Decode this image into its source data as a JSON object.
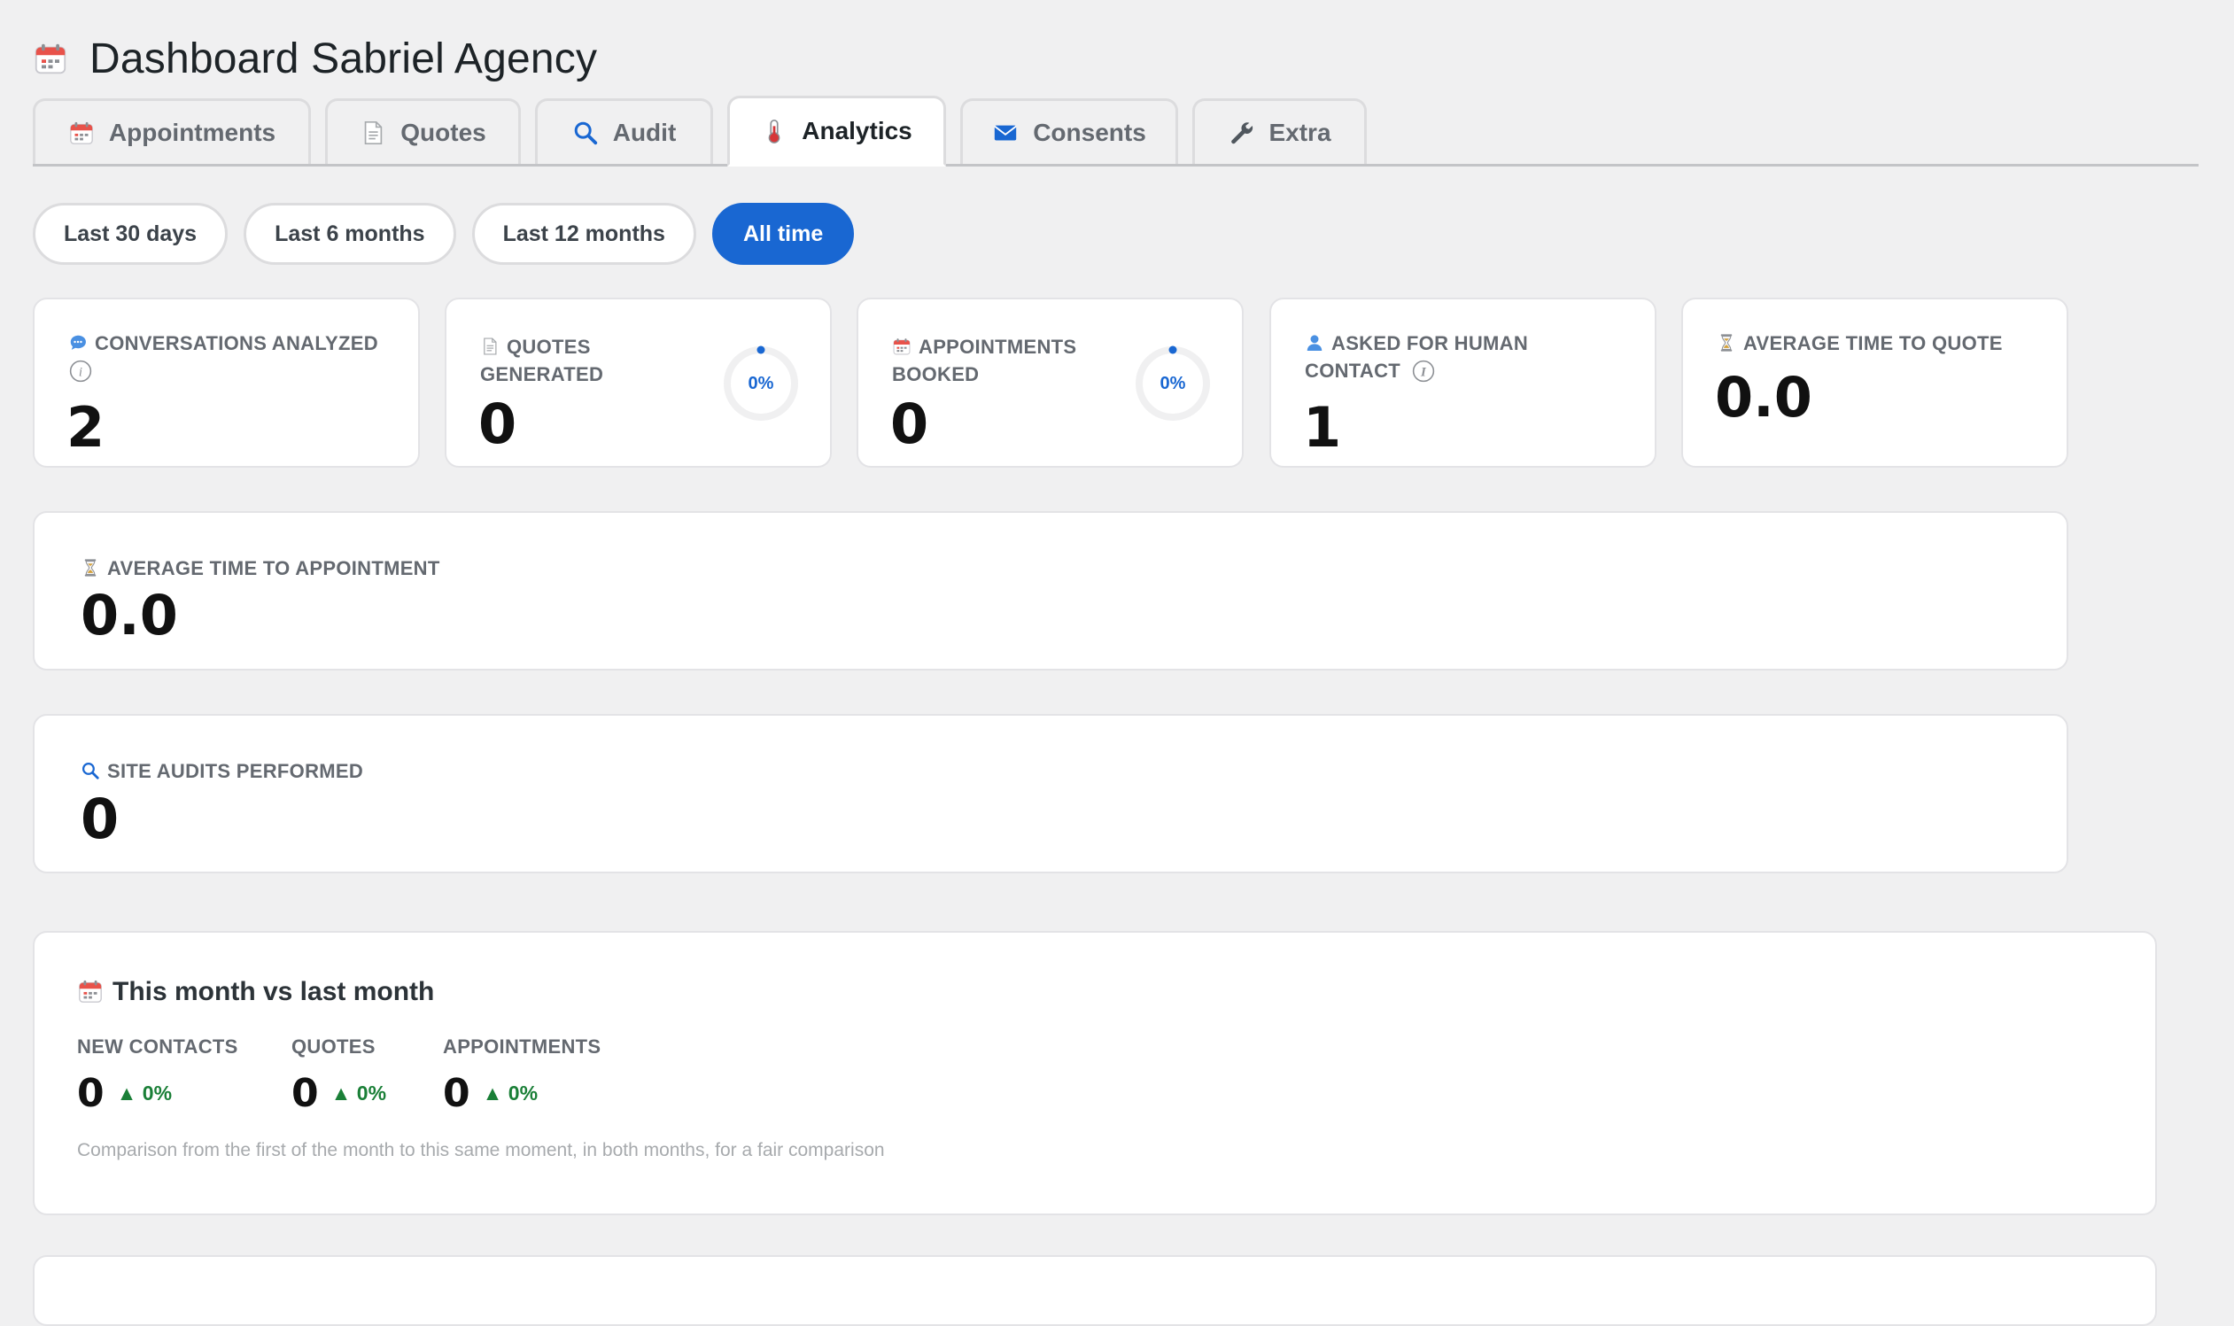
{
  "header": {
    "title": "Dashboard Sabriel Agency",
    "icon": "calendar-icon"
  },
  "tabs": [
    {
      "label": "Appointments",
      "icon": "calendar-icon",
      "active": false
    },
    {
      "label": "Quotes",
      "icon": "document-icon",
      "active": false
    },
    {
      "label": "Audit",
      "icon": "search-icon",
      "active": false
    },
    {
      "label": "Analytics",
      "icon": "thermometer-icon",
      "active": true
    },
    {
      "label": "Consents",
      "icon": "envelope-icon",
      "active": false
    },
    {
      "label": "Extra",
      "icon": "wrench-icon",
      "active": false
    }
  ],
  "filters": [
    {
      "label": "Last 30 days",
      "active": false
    },
    {
      "label": "Last 6 months",
      "active": false
    },
    {
      "label": "Last 12 months",
      "active": false
    },
    {
      "label": "All time",
      "active": true
    }
  ],
  "kpis": {
    "conversations": {
      "label": "CONVERSATIONS ANALYZED",
      "value": "2",
      "icon": "chat-bubble-icon"
    },
    "quotes": {
      "label_line1": "QUOTES",
      "label_line2": "GENERATED",
      "value": "0",
      "percent": "0%",
      "icon": "document-icon"
    },
    "appointments": {
      "label_line1": "APPOINTMENTS",
      "label_line2": "BOOKED",
      "value": "0",
      "percent": "0%",
      "icon": "calendar-icon"
    },
    "human_contact": {
      "label_line1": "ASKED FOR HUMAN",
      "label_line2": "CONTACT",
      "value": "1",
      "icon": "person-icon"
    },
    "avg_quote": {
      "label": "AVERAGE TIME TO QUOTE",
      "value": "0.0",
      "icon": "hourglass-icon"
    }
  },
  "avg_appointment": {
    "label": "AVERAGE TIME TO APPOINTMENT",
    "value": "0.0",
    "icon": "hourglass-icon"
  },
  "site_audits": {
    "label": "SITE AUDITS PERFORMED",
    "value": "0",
    "icon": "search-icon"
  },
  "comparison": {
    "title": "This month vs last month",
    "icon": "calendar-icon",
    "columns": [
      {
        "label": "NEW CONTACTS",
        "value": "0",
        "delta": "▲ 0%"
      },
      {
        "label": "QUOTES",
        "value": "0",
        "delta": "▲ 0%"
      },
      {
        "label": "APPOINTMENTS",
        "value": "0",
        "delta": "▲ 0%"
      }
    ],
    "note": "Comparison from the first of the month to this same moment, in both months, for a fair comparison"
  },
  "colors": {
    "accent": "#1967d2",
    "positive": "#1a7f37",
    "background": "#f0f0f1"
  }
}
